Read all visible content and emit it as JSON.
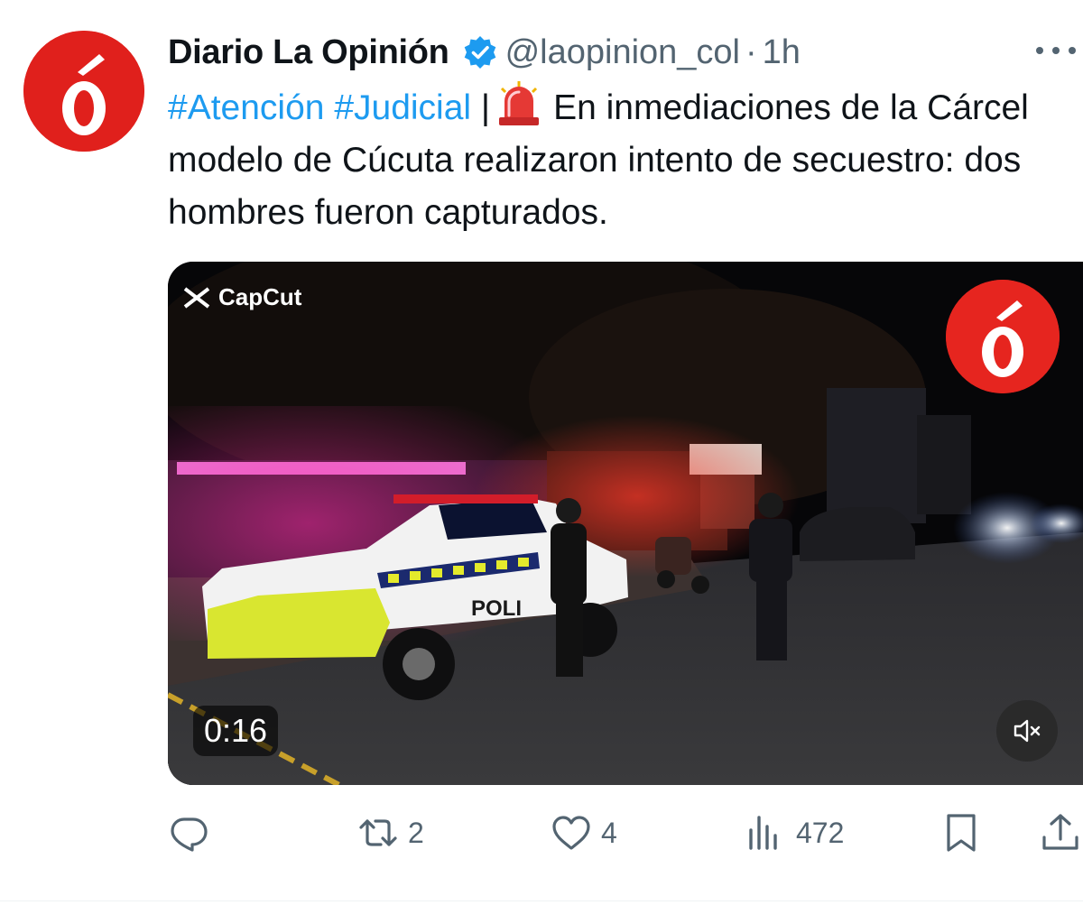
{
  "author": {
    "display_name": "Diario La Opinión",
    "handle": "@laopinion_col",
    "separator": "·",
    "time": "1h",
    "verified": true,
    "avatar_glyph": "ó",
    "avatar_color": "#e0201c"
  },
  "tweet": {
    "hashtag_1": "#Atención",
    "hashtag_2": "#Judicial",
    "pipe": "|",
    "body": "En inmediaciones de la Cárcel modelo de Cúcuta realizaron intento de secuestro: dos hombres fueron  capturados.",
    "emoji": "siren-icon"
  },
  "media": {
    "watermark": "CapCut",
    "logo_glyph": "ó",
    "duration": "0:16",
    "muted": true,
    "vehicle_text": "POLI"
  },
  "actions": {
    "reply_count": "",
    "retweet_count": "2",
    "like_count": "4",
    "view_count": "472"
  },
  "colors": {
    "hashtag": "#1d9bf0",
    "text": "#0f1419",
    "secondary": "#536471",
    "verified": "#1d9bf0",
    "brand_red": "#e0201c"
  }
}
